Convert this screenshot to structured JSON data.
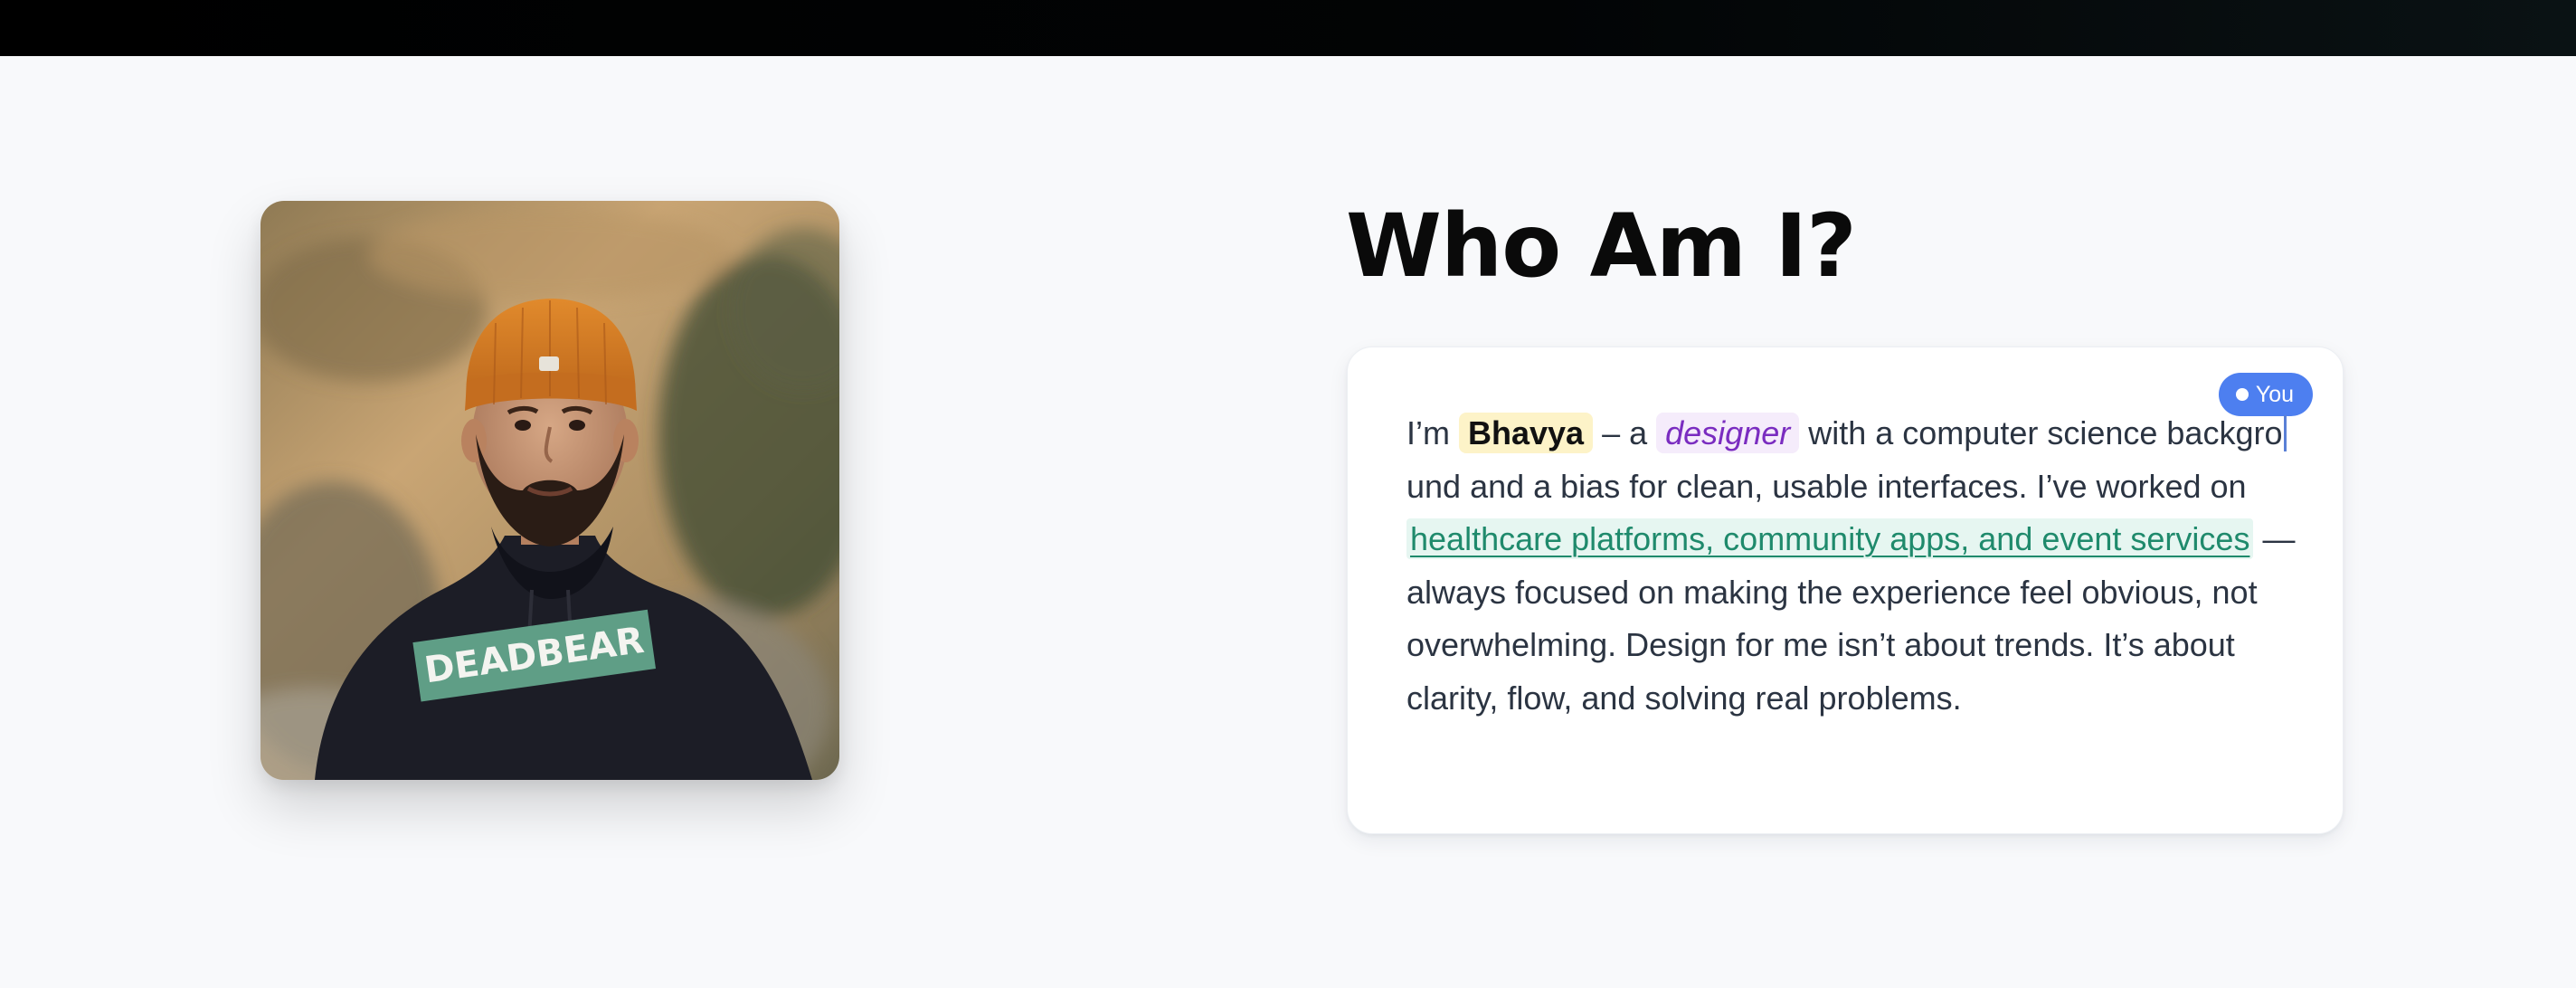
{
  "about": {
    "heading": "Who Am I?",
    "badge": "You",
    "bio": {
      "intro": "I’m ",
      "name": "Bhavya",
      "dash": " – a ",
      "role": "designer",
      "line1_rest_a": " with a computer science backgro",
      "line1_rest_b": "und and a bias for clean, usable interfaces. I’ve worked on ",
      "work": "healthcare platforms, community apps, and event services",
      "outro": " — always focused on making the experience feel obvious, not overwhelming. Design for me isn’t about trends. It’s about clarity, flow, and solving real problems."
    },
    "photo": {
      "hoodie_text": "DEADBEAR"
    }
  },
  "colors": {
    "accent": "#4d7ff0",
    "name_highlight": "#fdf3c8",
    "role_highlight": "#f5ecfb",
    "role_text": "#7a2cc0",
    "work_highlight": "#e6f6f1",
    "work_text": "#1f8a6c"
  },
  "icons": [
    "avatar-photo",
    "presence-dot-icon",
    "text-caret"
  ]
}
